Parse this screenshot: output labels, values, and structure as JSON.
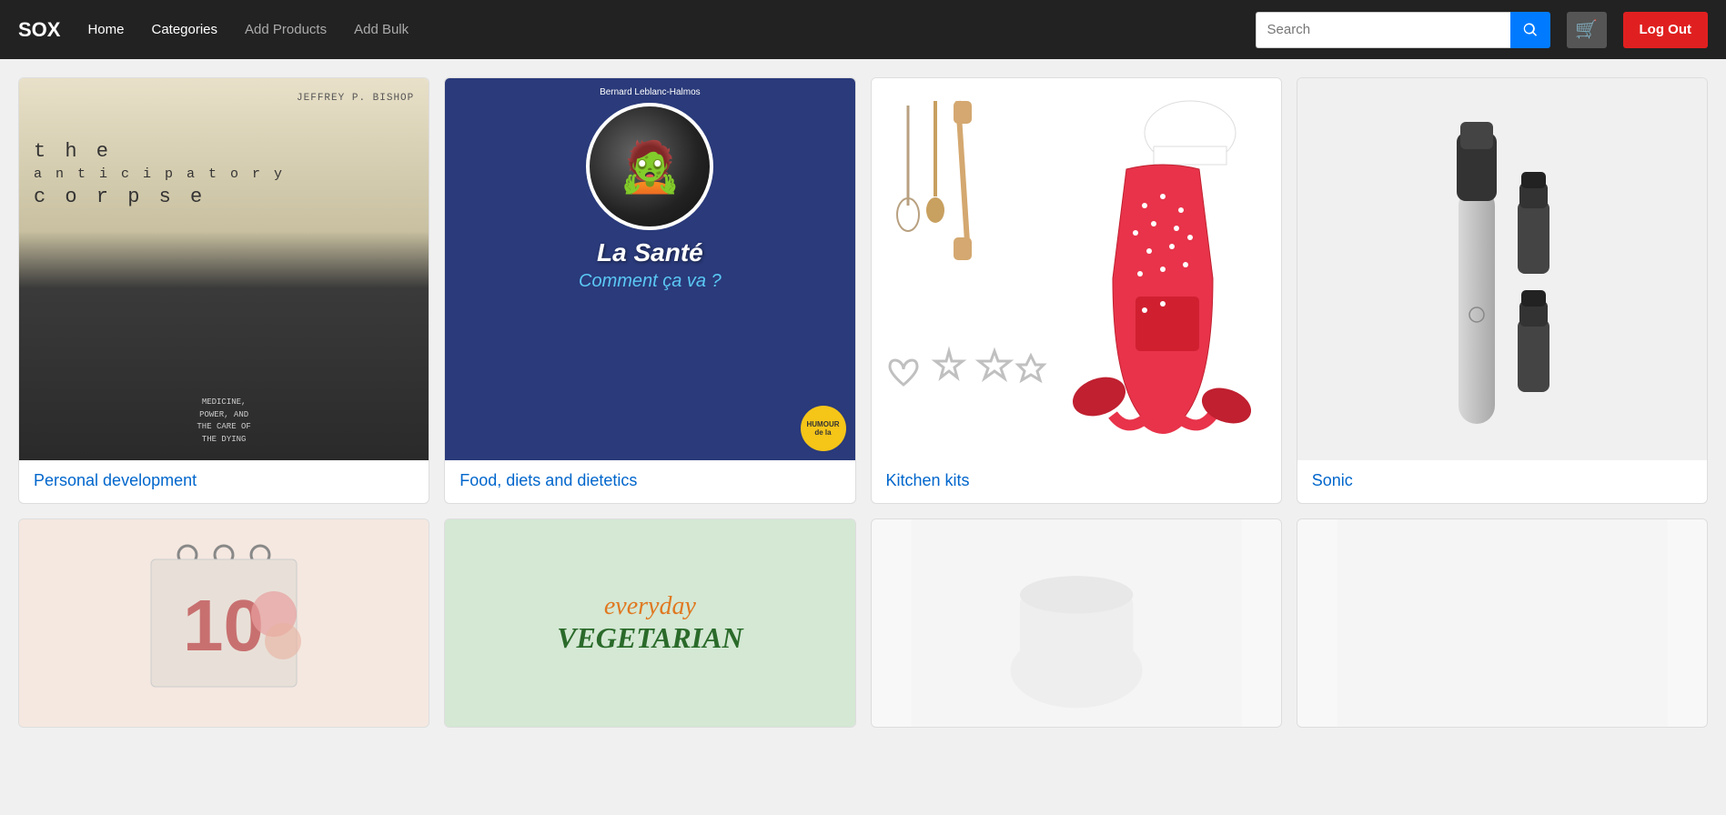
{
  "brand": "SOX",
  "navbar": {
    "links": [
      {
        "label": "Home",
        "muted": false
      },
      {
        "label": "Categories",
        "muted": false
      },
      {
        "label": "Add Products",
        "muted": true
      },
      {
        "label": "Add Bulk",
        "muted": true
      }
    ],
    "search_placeholder": "Search",
    "logout_label": "Log Out"
  },
  "products": [
    {
      "id": "personal-development",
      "label": "Personal development",
      "author": "JEFFREY P. BISHOP",
      "type": "book1"
    },
    {
      "id": "food-diets",
      "label": "Food, diets and dietetics",
      "title": "La Santé",
      "subtitle": "Comment ça va ?",
      "author": "Bernard Leblanc-Halmos",
      "type": "book2"
    },
    {
      "id": "kitchen-kits",
      "label": "Kitchen kits",
      "type": "kitchen"
    },
    {
      "id": "sonic",
      "label": "Sonic",
      "type": "sonic"
    }
  ],
  "partial_products": [
    {
      "id": "calendar",
      "type": "calendar"
    },
    {
      "id": "vegetarian",
      "type": "vegetarian"
    },
    {
      "id": "empty1",
      "type": "empty"
    },
    {
      "id": "empty2",
      "type": "empty"
    }
  ]
}
